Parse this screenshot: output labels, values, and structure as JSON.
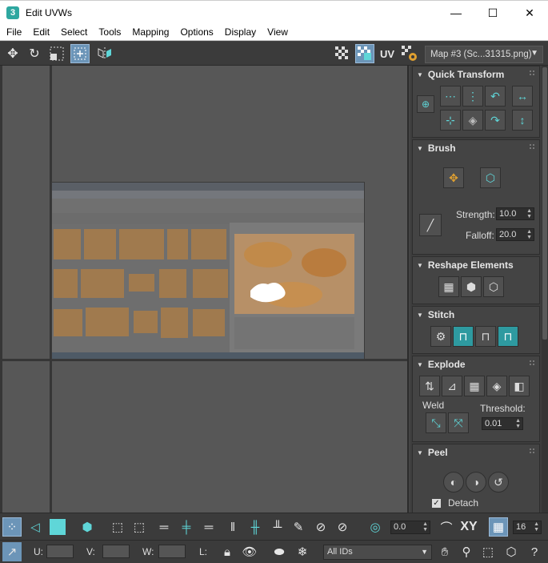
{
  "window": {
    "app_icon_glyph": "3",
    "title": "Edit UVWs",
    "minimize": "—",
    "maximize": "☐",
    "close": "✕"
  },
  "menu": [
    "File",
    "Edit",
    "Select",
    "Tools",
    "Mapping",
    "Options",
    "Display",
    "View"
  ],
  "toolbar": {
    "uv_label": "UV",
    "map_dropdown": "Map #3 (Sc...31315.png)"
  },
  "panel": {
    "quick_transform": {
      "title": "Quick Transform"
    },
    "brush": {
      "title": "Brush",
      "strength_label": "Strength:",
      "strength_value": "10.0",
      "falloff_label": "Falloff:",
      "falloff_value": "20.0"
    },
    "reshape": {
      "title": "Reshape Elements"
    },
    "stitch": {
      "title": "Stitch"
    },
    "explode": {
      "title": "Explode",
      "weld_label": "Weld",
      "threshold_label": "Threshold:",
      "threshold_value": "0.01"
    },
    "peel": {
      "title": "Peel",
      "detach_label": "Detach",
      "detach_checked": true
    }
  },
  "bottom": {
    "offset_value": "0.0",
    "xy_label": "XY",
    "grid_value": "16",
    "u_label": "U:",
    "v_label": "V:",
    "w_label": "W:",
    "l_label": "L:",
    "ids_dropdown": "All IDs"
  },
  "colors": {
    "accent_teal": "#5fd6d8",
    "active_blue": "#6c95b8",
    "panel_bg": "#444444",
    "viewport_bg": "#575757"
  }
}
